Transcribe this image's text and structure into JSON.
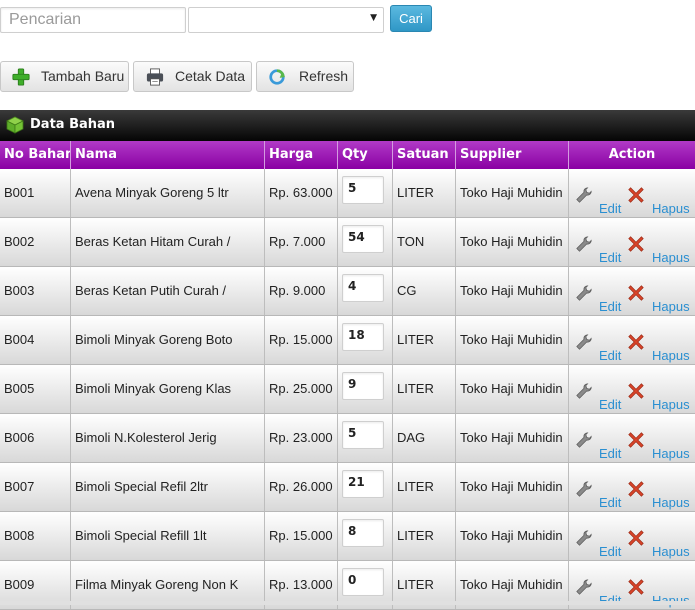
{
  "search": {
    "placeholder": "Pencarian",
    "button_label": "Cari",
    "select_value": ""
  },
  "toolbar": {
    "add_label": "Tambah Baru",
    "print_label": "Cetak Data",
    "refresh_label": "Refresh"
  },
  "panel": {
    "title": "Data Bahan"
  },
  "table": {
    "headers": [
      "No Bahan",
      "Nama",
      "Harga",
      "Qty",
      "Satuan",
      "Supplier",
      "Action"
    ],
    "edit_label": "Edit",
    "delete_label": "Hapus",
    "rows": [
      {
        "no": "B001",
        "nama": "Avena Minyak Goreng 5 ltr",
        "harga": "Rp. 63.000",
        "qty": "5",
        "satuan": "LITER",
        "supplier": "Toko Haji Muhidin"
      },
      {
        "no": "B002",
        "nama": "Beras Ketan Hitam Curah /",
        "harga": "Rp. 7.000",
        "qty": "54",
        "satuan": "TON",
        "supplier": "Toko Haji Muhidin"
      },
      {
        "no": "B003",
        "nama": "Beras Ketan Putih Curah /",
        "harga": "Rp. 9.000",
        "qty": "4",
        "satuan": "CG",
        "supplier": "Toko Haji Muhidin"
      },
      {
        "no": "B004",
        "nama": "Bimoli Minyak Goreng Boto",
        "harga": "Rp. 15.000",
        "qty": "18",
        "satuan": "LITER",
        "supplier": "Toko Haji Muhidin"
      },
      {
        "no": "B005",
        "nama": "Bimoli Minyak Goreng Klas",
        "harga": "Rp. 25.000",
        "qty": "9",
        "satuan": "LITER",
        "supplier": "Toko Haji Muhidin"
      },
      {
        "no": "B006",
        "nama": "Bimoli N.Kolesterol Jerig",
        "harga": "Rp. 23.000",
        "qty": "5",
        "satuan": "DAG",
        "supplier": "Toko Haji Muhidin"
      },
      {
        "no": "B007",
        "nama": "Bimoli Special Refil 2ltr",
        "harga": "Rp. 26.000",
        "qty": "21",
        "satuan": "LITER",
        "supplier": "Toko Haji Muhidin"
      },
      {
        "no": "B008",
        "nama": "Bimoli Special Refill 1lt",
        "harga": "Rp. 15.000",
        "qty": "8",
        "satuan": "LITER",
        "supplier": "Toko Haji Muhidin"
      },
      {
        "no": "B009",
        "nama": "Filma Minyak Goreng Non K",
        "harga": "Rp. 13.000",
        "qty": "0",
        "satuan": "LITER",
        "supplier": "Toko Haji Muhidin"
      }
    ]
  },
  "colors": {
    "header_purple": "#8a00a3",
    "link_blue": "#2a8fd1",
    "button_blue": "#3aa6d2"
  }
}
